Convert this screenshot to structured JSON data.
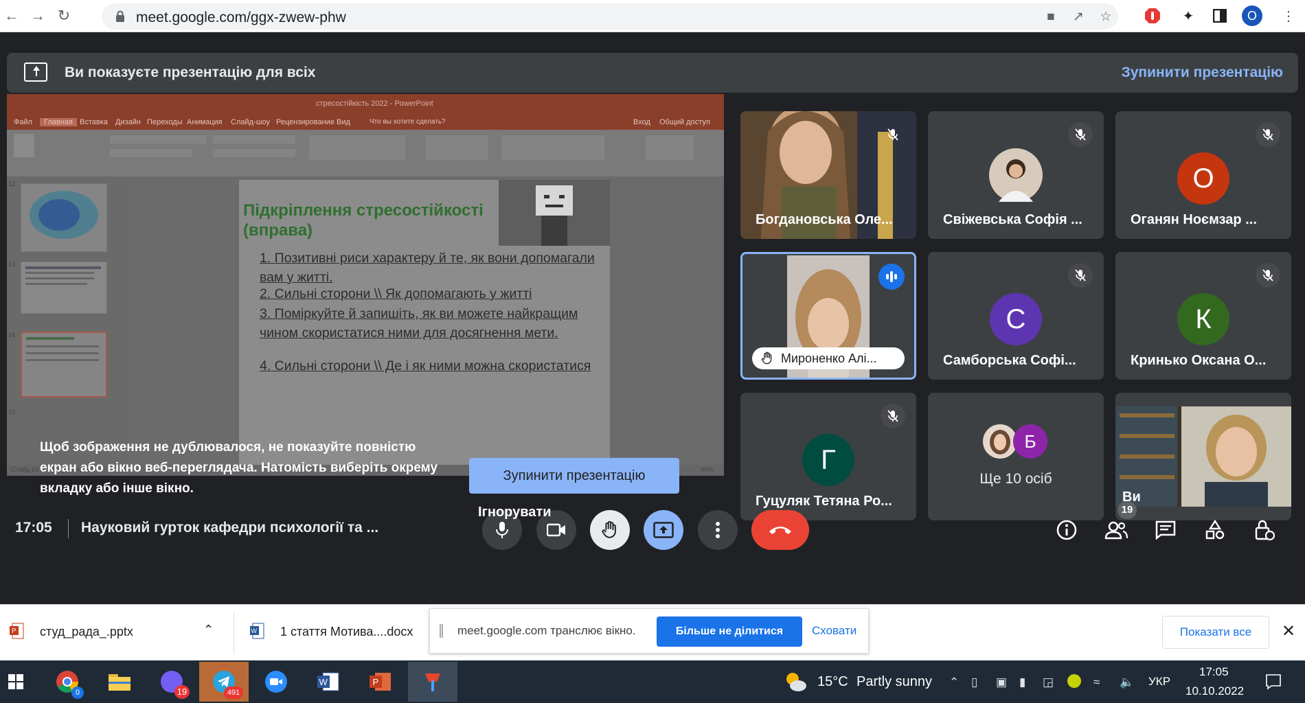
{
  "browser": {
    "url": "meet.google.com/ggx-zwew-phw",
    "profile_initial": "O"
  },
  "banner": {
    "text": "Ви показуєте презентацію для всіх",
    "stop_label": "Зупинити презентацію"
  },
  "presentation": {
    "window_title": "стресостійкість 2022 - PowerPoint",
    "menu": [
      "Файл",
      "Главная",
      "Вставка",
      "Дизайн",
      "Переходы",
      "Анимация",
      "Слайд-шоу",
      "Рецензирование",
      "Вид",
      "Что вы хотите сделать?",
      "Вход",
      "Общий доступ"
    ],
    "slide_title": "Підкріплення стресостійкості (вправа)",
    "items": [
      "1.  Позитивні риси характеру й те, як вони допомагали вам у житті.",
      "2.  Сильні сторони \\\\ Як допомагають у житті",
      "3.  Поміркуйте й запишіть, як ви можете найкращим чином скористатися ними для досягнення мети.",
      "4.  Сильні сторони \\\\ Де і як ними можна скористатися"
    ],
    "thumb_numbers": [
      "12",
      "13",
      "14",
      "15"
    ],
    "status_left": "Слайд 14 из 21",
    "status_lang": "украинский",
    "zoom": "49%"
  },
  "overlay": {
    "message": "Щоб зображення не дублювалося, не показуйте повністю екран або вікно веб-переглядача. Натомість виберіть окрему вкладку або інше вікно.",
    "stop_button": "Зупинити презентацію",
    "ignore_label": "Ігнорувати"
  },
  "participants": [
    {
      "name": "Богдановська Оле...",
      "kind": "video"
    },
    {
      "name": "Свіжевська Софія ...",
      "kind": "photo"
    },
    {
      "name": "Оганян Ноємзар ...",
      "initial": "О",
      "color": "#c5360f"
    },
    {
      "name": "Мироненко Алі...",
      "kind": "video",
      "speaking": true,
      "hand_raised": true
    },
    {
      "name": "Самборська Софі...",
      "initial": "С",
      "color": "#5e35b1"
    },
    {
      "name": "Кринько Оксана О...",
      "initial": "К",
      "color": "#33691e"
    },
    {
      "name": "Гуцуляк Тетяна Ро...",
      "initial": "Г",
      "color": "#004d40"
    },
    {
      "name": "Ще 10 осіб",
      "initial": "Б",
      "color": "#8e24aa"
    },
    {
      "name": "Ви",
      "kind": "video"
    }
  ],
  "bottom": {
    "time": "17:05",
    "meeting_title": "Науковий гурток кафедри психології та ...",
    "participants_count": "19"
  },
  "shelf": {
    "file1": "студ_рада_.pptx",
    "file2": "1 стаття Мотива....docx",
    "share_text": "meet.google.com транслює вікно.",
    "share_stop": "Більше не ділитися",
    "share_hide": "Сховати",
    "show_all": "Показати все"
  },
  "taskbar": {
    "chrome_badge": "0",
    "viber_badge": "19",
    "telegram_badge": "491",
    "weather_temp": "15°C",
    "weather_desc": "Partly sunny",
    "lang": "УКР",
    "clock_time": "17:05",
    "clock_date": "10.10.2022"
  },
  "colors": {
    "meet_bg": "#202124",
    "tile_bg": "#3c4043",
    "accent": "#8ab4f8",
    "end_call": "#ea4335",
    "share_btn": "#1a73e8"
  }
}
